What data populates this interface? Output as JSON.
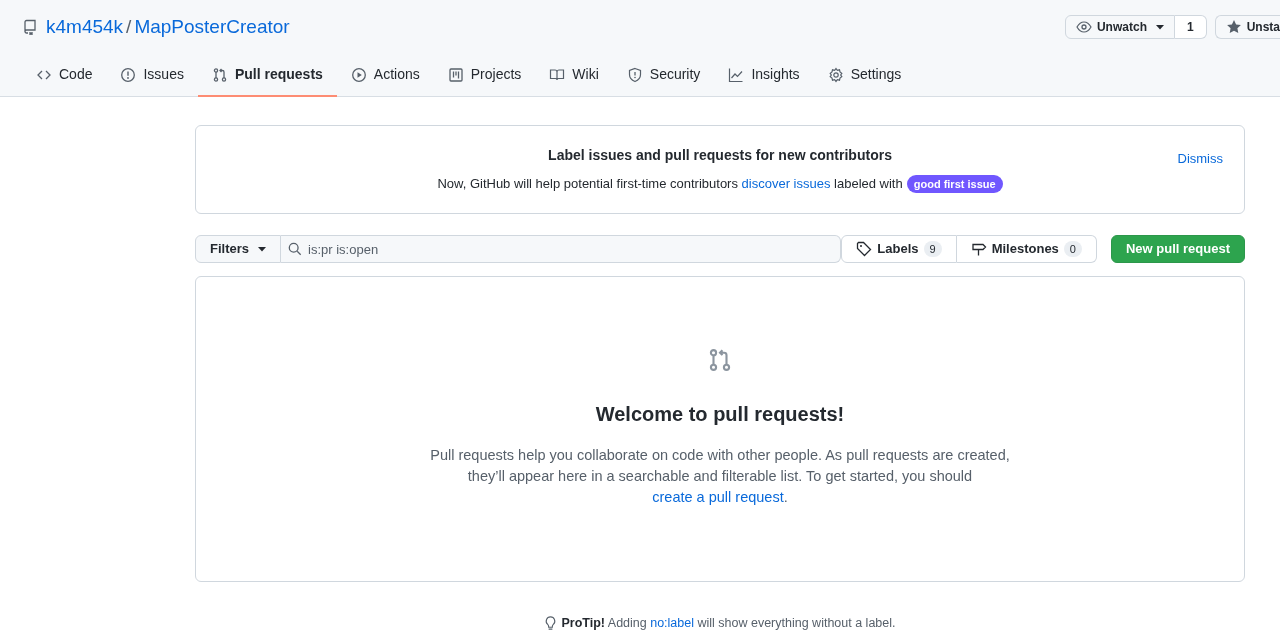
{
  "repo": {
    "owner": "k4m454k",
    "separator": "/",
    "name": "MapPosterCreator"
  },
  "header_buttons": [
    {
      "label": "Unwatch",
      "kind": "watch",
      "count": "1"
    },
    {
      "label": "Unsta",
      "kind": "star"
    }
  ],
  "tabs": [
    {
      "label": "Code",
      "selected": false
    },
    {
      "label": "Issues",
      "selected": false
    },
    {
      "label": "Pull requests",
      "selected": true
    },
    {
      "label": "Actions",
      "selected": false
    },
    {
      "label": "Projects",
      "selected": false
    },
    {
      "label": "Wiki",
      "selected": false
    },
    {
      "label": "Security",
      "selected": false
    },
    {
      "label": "Insights",
      "selected": false
    },
    {
      "label": "Settings",
      "selected": false
    }
  ],
  "notice": {
    "title": "Label issues and pull requests for new contributors",
    "text_before": "Now, GitHub will help potential first-time contributors ",
    "link": "discover issues",
    "text_after": " labeled with",
    "label_badge": "good first issue",
    "dismiss": "Dismiss"
  },
  "toolbar": {
    "filters": "Filters",
    "search_value": "is:pr is:open",
    "labels": "Labels",
    "labels_count": "9",
    "milestones": "Milestones",
    "milestones_count": "0",
    "new_button": "New pull request"
  },
  "blankslate": {
    "title": "Welcome to pull requests!",
    "text": "Pull requests help you collaborate on code with other people. As pull requests are created, they’ll appear here in a searchable and filterable list. To get started, you should ",
    "link": "create a pull request",
    "text_after": "."
  },
  "protip": {
    "lead": "ProTip!",
    "text_before": " Adding ",
    "link": "no:label",
    "text_after": " will show everything without a label."
  }
}
